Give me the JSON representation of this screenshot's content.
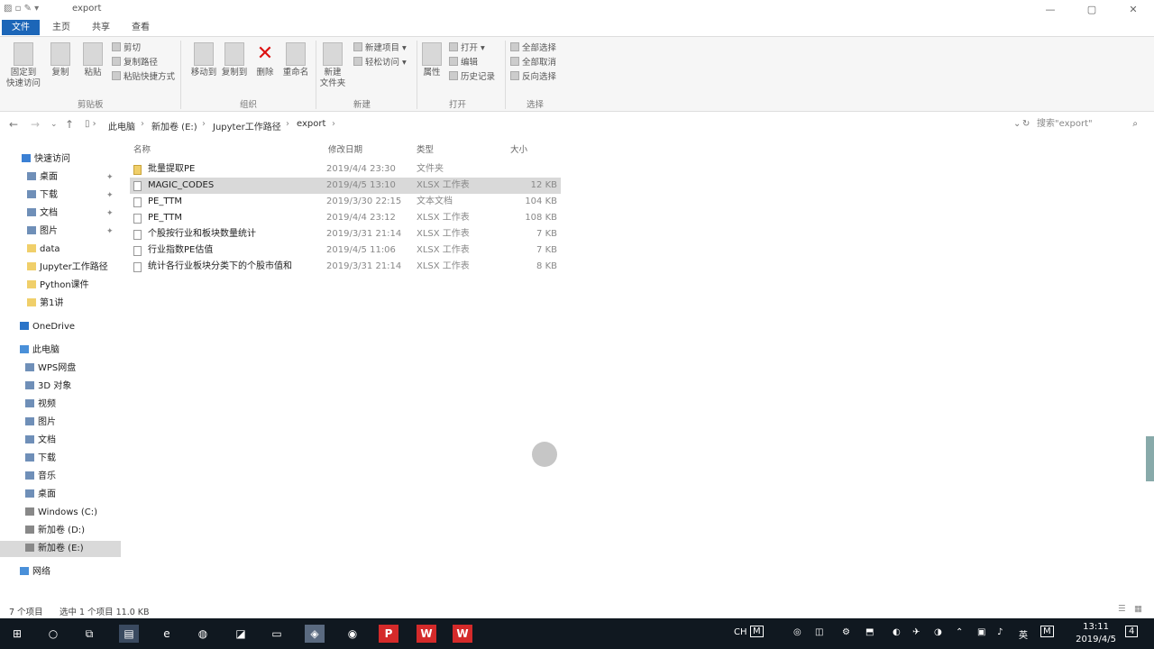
{
  "window": {
    "title": "export",
    "controls": [
      "—",
      "▢",
      "✕"
    ]
  },
  "ribbon_tabs": [
    "文件",
    "主页",
    "共享",
    "查看"
  ],
  "ribbon": {
    "clipboard": {
      "pin_label": "固定到\n快速访问",
      "copy_label": "复制",
      "paste_label": "粘贴",
      "cut_label": "剪切",
      "copy_path_label": "复制路径",
      "paste_shortcut_label": "粘贴快捷方式",
      "group_label": "剪贴板"
    },
    "organize": {
      "move_to_label": "移动到",
      "copy_to_label": "复制到",
      "delete_label": "删除",
      "rename_label": "重命名",
      "group_label": "组织"
    },
    "new": {
      "new_folder_label": "新建\n文件夹",
      "new_item_label": "新建项目",
      "easy_access_label": "轻松访问",
      "group_label": "新建"
    },
    "open": {
      "properties_label": "属性",
      "open_label": "打开",
      "edit_label": "编辑",
      "history_label": "历史记录",
      "group_label": "打开"
    },
    "select": {
      "select_all_label": "全部选择",
      "select_none_label": "全部取消",
      "invert_label": "反向选择",
      "group_label": "选择"
    }
  },
  "address": {
    "crumbs": [
      "此电脑",
      "新加卷 (E:)",
      "Jupyter工作路径",
      "export"
    ],
    "search_placeholder": "搜索\"export\""
  },
  "nav_pane": {
    "quick_access": "快速访问",
    "quick_items": [
      {
        "label": "桌面",
        "pinned": true
      },
      {
        "label": "下载",
        "pinned": true
      },
      {
        "label": "文档",
        "pinned": true
      },
      {
        "label": "图片",
        "pinned": true
      },
      {
        "label": "data",
        "pinned": false
      },
      {
        "label": "Jupyter工作路径",
        "pinned": false
      },
      {
        "label": "Python课件",
        "pinned": false
      },
      {
        "label": "第1讲",
        "pinned": false
      }
    ],
    "onedrive": "OneDrive",
    "this_pc": "此电脑",
    "pc_items": [
      "WPS网盘",
      "3D 对象",
      "视频",
      "图片",
      "文档",
      "下载",
      "音乐",
      "桌面",
      "Windows (C:)",
      "新加卷 (D:)",
      "新加卷 (E:)"
    ],
    "network": "网络"
  },
  "columns": {
    "name": "名称",
    "date": "修改日期",
    "type": "类型",
    "size": "大小"
  },
  "files": [
    {
      "name": "批量提取PE",
      "date": "2019/4/4 23:30",
      "type": "文件夹",
      "size": "",
      "folder": true
    },
    {
      "name": "MAGIC_CODES",
      "date": "2019/4/5 13:10",
      "type": "XLSX 工作表",
      "size": "12 KB",
      "folder": false
    },
    {
      "name": "PE_TTM",
      "date": "2019/3/30 22:15",
      "type": "文本文档",
      "size": "104 KB",
      "folder": false
    },
    {
      "name": "PE_TTM",
      "date": "2019/4/4 23:12",
      "type": "XLSX 工作表",
      "size": "108 KB",
      "folder": false
    },
    {
      "name": "个股按行业和板块数量统计",
      "date": "2019/3/31 21:14",
      "type": "XLSX 工作表",
      "size": "7 KB",
      "folder": false
    },
    {
      "name": "行业指数PE估值",
      "date": "2019/4/5 11:06",
      "type": "XLSX 工作表",
      "size": "7 KB",
      "folder": false
    },
    {
      "name": "统计各行业板块分类下的个股市值和",
      "date": "2019/3/31 21:14",
      "type": "XLSX 工作表",
      "size": "8 KB",
      "folder": false
    }
  ],
  "status": {
    "count": "7 个项目",
    "selection": "选中 1 个项目 11.0 KB"
  },
  "taskbar": {
    "lang": "英",
    "ime": "CH",
    "time": "13:11",
    "date": "2019/4/5",
    "notif": "4"
  }
}
